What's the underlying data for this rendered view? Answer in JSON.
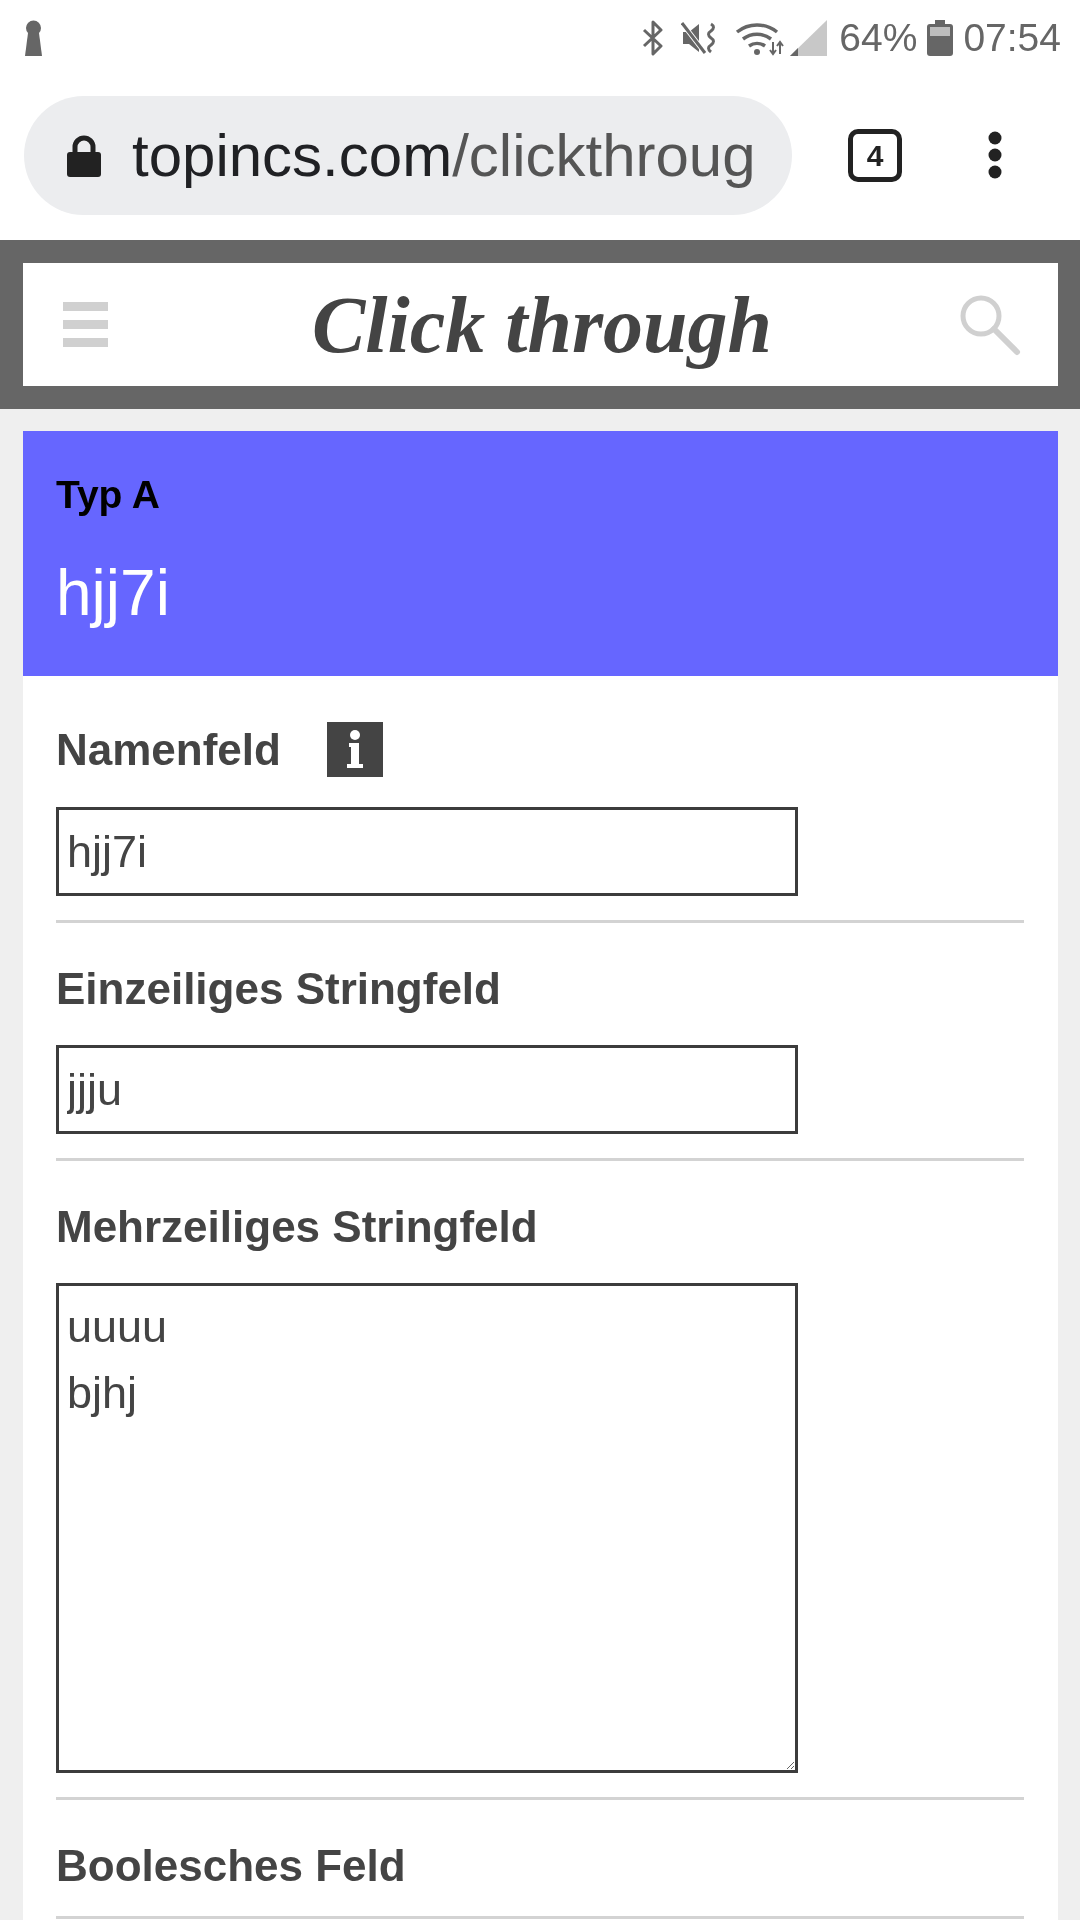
{
  "status_bar": {
    "battery_percent": "64%",
    "time": "07:54"
  },
  "browser": {
    "url": {
      "host": "topincs.com",
      "path": "/clickthroug"
    },
    "tab_count": "4"
  },
  "header": {
    "title": "Click through"
  },
  "record": {
    "type_label": "Typ A",
    "name": "hjj7i",
    "fields": [
      {
        "kind": "text",
        "label": "Namenfeld",
        "info": true,
        "value": "hjj7i"
      },
      {
        "kind": "text",
        "label": "Einzeiliges Stringfeld",
        "info": false,
        "value": "jjju"
      },
      {
        "kind": "textarea",
        "label": "Mehrzeiliges Stringfeld",
        "info": false,
        "value": "uuuu\nbjhj"
      },
      {
        "kind": "boolean",
        "label": "Boolesches Feld",
        "info": false
      }
    ]
  }
}
